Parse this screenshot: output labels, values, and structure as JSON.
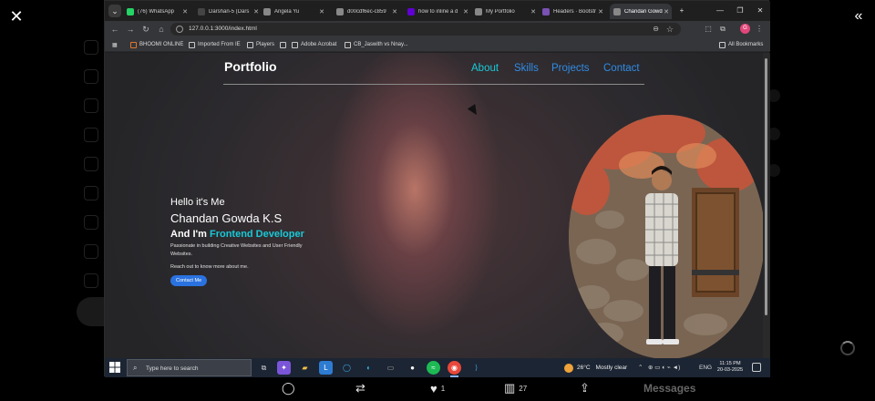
{
  "viewer": {
    "close_icon": "close-icon",
    "collapse_icon": "double-chevron-left-icon"
  },
  "browser": {
    "tabs": [
      {
        "label": "(76) WhatsApp",
        "icon": "whatsapp-icon",
        "color": "#25d366"
      },
      {
        "label": "Darshan-5 (Dars",
        "icon": "page-icon",
        "color": "#444444"
      },
      {
        "label": "Angela Yu",
        "icon": "globe-icon",
        "color": "#888888"
      },
      {
        "label": "d00cdf6ec-c859",
        "icon": "globe-icon",
        "color": "#888888"
      },
      {
        "label": "how to inline a d",
        "icon": "yahoo-icon",
        "color": "#6001d2"
      },
      {
        "label": "My Portfolio",
        "icon": "globe-icon",
        "color": "#888888"
      },
      {
        "label": "Headers · Bootstr",
        "icon": "bootstrap-icon",
        "color": "#7952b3"
      },
      {
        "label": "Chandan Gowda",
        "icon": "globe-icon",
        "color": "#888888",
        "active": true
      }
    ],
    "new_tab_label": "+",
    "url": "127.0.0.1:3000/index.html",
    "bookmarks": [
      {
        "label": "BHOOMI ONLINE",
        "color": "#e0762b"
      },
      {
        "label": "Imported From IE",
        "color": "#c9c9c9"
      },
      {
        "label": "Players",
        "color": "#c9c9c9"
      },
      {
        "label": "",
        "color": "#c9c9c9"
      },
      {
        "label": "Adobe Acrobat",
        "color": "#c9c9c9"
      },
      {
        "label": "CB_Jaswith vs Nnay...",
        "color": "#c9c9c9"
      }
    ],
    "all_bookmarks_label": "All Bookmarks",
    "avatar_letter": "G"
  },
  "page": {
    "brand": "Portfolio",
    "nav": [
      {
        "label": "About",
        "color": "#19c9d8"
      },
      {
        "label": "Skills",
        "color": "#2f8ce6"
      },
      {
        "label": "Projects",
        "color": "#2f8ce6"
      },
      {
        "label": "Contact",
        "color": "#2f8ce6"
      }
    ],
    "hero": {
      "hello": "Hello it's Me",
      "name": "Chandan Gowda K.S",
      "iam_prefix": "And I'm",
      "role": "Frontend Developer",
      "description": "Passionate in building Creative Websites and User Friendly Websites.",
      "cta_text": "Reach out to know more about me.",
      "cta_button": "Contact Me"
    }
  },
  "taskbar": {
    "search_placeholder": "Type here to search",
    "weather_temp": "26°C",
    "weather_condition": "Mostly clear",
    "language": "ENG",
    "time": "11:15 PM",
    "date": "20-03-2025"
  },
  "actions": {
    "reply_count": "",
    "repost_count": "",
    "like_count": "1",
    "views_count": "27"
  },
  "side": {
    "messages_label": "Messages"
  }
}
